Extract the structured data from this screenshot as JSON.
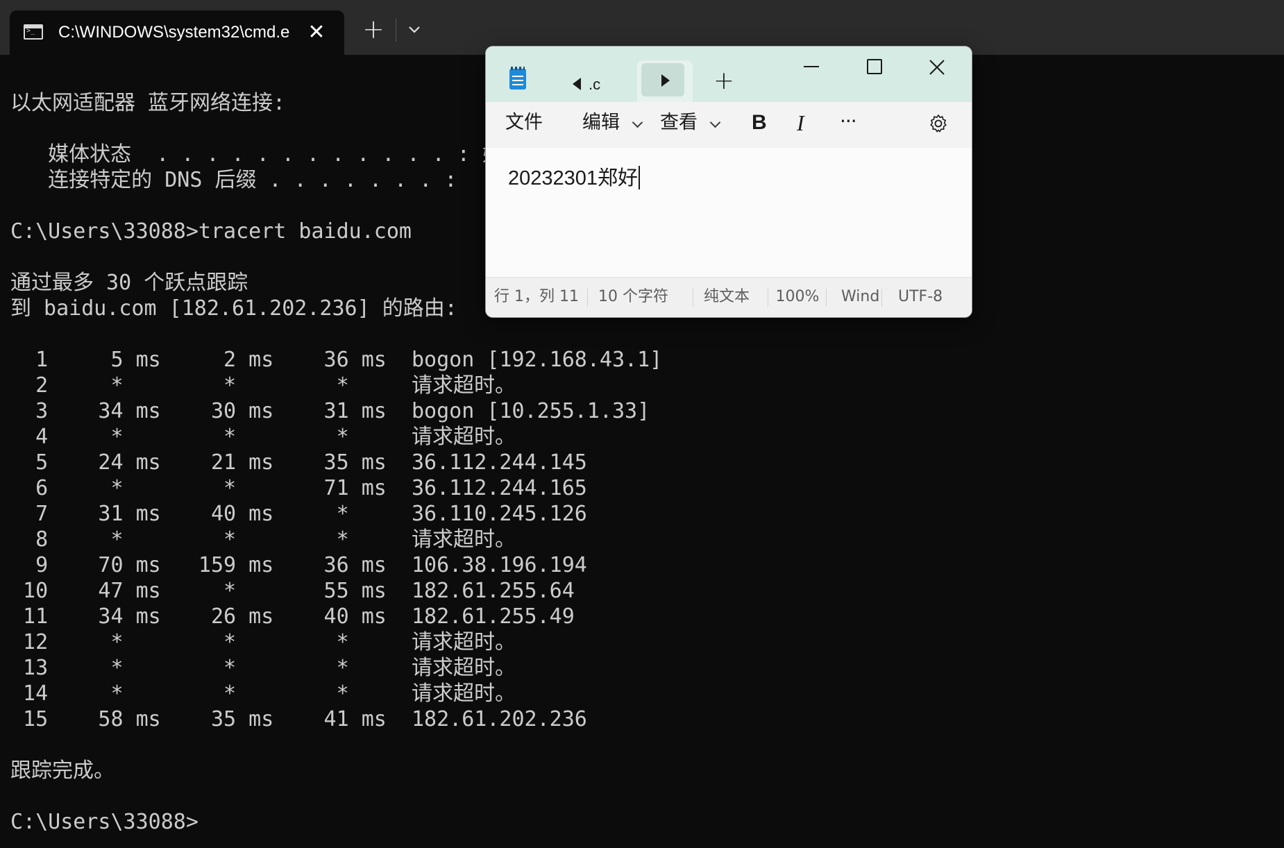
{
  "terminal": {
    "tab_title": "C:\\WINDOWS\\system32\\cmd.e",
    "new_tab_symbol": "+",
    "close_symbol": "✕",
    "lines": [
      "以太网适配器 蓝牙网络连接:",
      "",
      "   媒体状态  . . . . . . . . . . . . : 媒体已断开连接",
      "   连接特定的 DNS 后缀 . . . . . . . :",
      "",
      "C:\\Users\\33088>tracert baidu.com",
      "",
      "通过最多 30 个跃点跟踪",
      "到 baidu.com [182.61.202.236] 的路由:",
      "",
      "  1     5 ms     2 ms    36 ms  bogon [192.168.43.1]",
      "  2     *        *        *     请求超时。",
      "  3    34 ms    30 ms    31 ms  bogon [10.255.1.33]",
      "  4     *        *        *     请求超时。",
      "  5    24 ms    21 ms    35 ms  36.112.244.145",
      "  6     *        *       71 ms  36.112.244.165",
      "  7    31 ms    40 ms     *     36.110.245.126",
      "  8     *        *        *     请求超时。",
      "  9    70 ms   159 ms    36 ms  106.38.196.194",
      " 10    47 ms     *       55 ms  182.61.255.64",
      " 11    34 ms    26 ms    40 ms  182.61.255.49",
      " 12     *        *        *     请求超时。",
      " 13     *        *        *     请求超时。",
      " 14     *        *        *     请求超时。",
      " 15    58 ms    35 ms    41 ms  182.61.202.236",
      "",
      "跟踪完成。",
      "",
      "C:\\Users\\33088>"
    ]
  },
  "notepad": {
    "tab_prev_label": ".c",
    "new_tab_symbol": "+",
    "close_symbol": "✕",
    "menu": {
      "file": "文件",
      "edit": "编辑",
      "view": "查看",
      "bold": "B",
      "italic": "I",
      "more": "···"
    },
    "content": "20232301郑好",
    "status": {
      "position": "行 1，列 11",
      "chars": "10 个字符",
      "format": "纯文本",
      "zoom": "100%",
      "line_ending": "Windows (CRLF)",
      "encoding": "UTF-8"
    }
  },
  "colors": {
    "terminal_bg": "#0c0c0c",
    "terminal_text": "#cccccc",
    "notepad_title": "#d6ebe4"
  }
}
